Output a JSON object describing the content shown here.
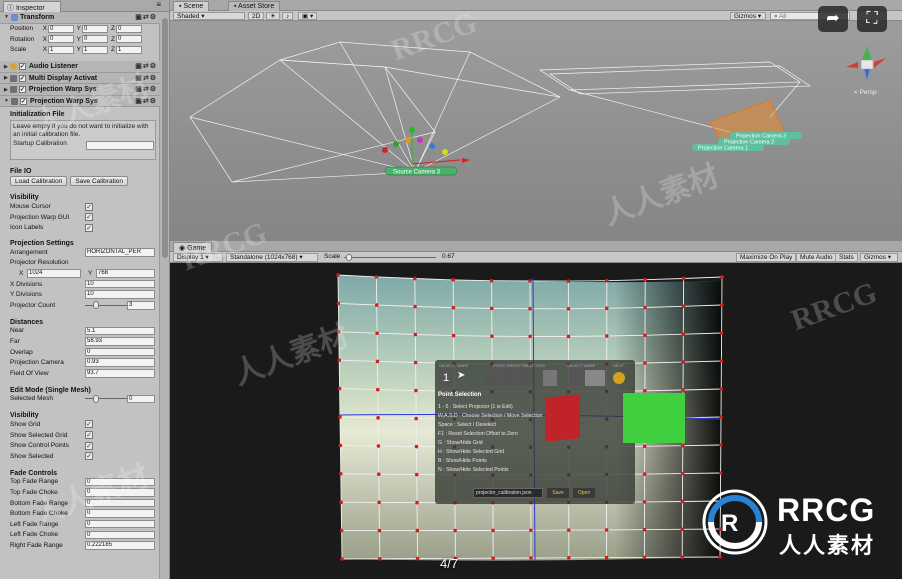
{
  "inspector": {
    "tab": "Inspector",
    "transform": {
      "title": "Transform",
      "rows": [
        {
          "label": "Position",
          "x": "0",
          "y": "0",
          "z": "0"
        },
        {
          "label": "Rotation",
          "x": "0",
          "y": "0",
          "z": "0"
        },
        {
          "label": "Scale",
          "x": "1",
          "y": "1",
          "z": "1"
        }
      ]
    },
    "components": [
      "Audio Listener",
      "Multi Display Activat",
      "Projection Warp Sys",
      "Projection Warp Sys"
    ],
    "init_file": {
      "heading": "Initialization File",
      "help": "Leave empty if you do not want to initialize with an initial calibration file.",
      "startup_label": "Startup Calibration",
      "startup_value": ""
    },
    "file_io": {
      "heading": "File IO",
      "load": "Load Calibration",
      "save": "Save Calibration"
    },
    "visibility": {
      "heading": "Visibility",
      "items": [
        {
          "label": "Mouse Cursor",
          "checked": true
        },
        {
          "label": "Projection Warp GUI",
          "checked": true
        },
        {
          "label": "Icon Labels",
          "checked": true
        }
      ]
    },
    "projection_settings": {
      "heading": "Projection Settings",
      "arrangement_label": "Arrangement",
      "arrangement_value": "HORIZONTAL_PER",
      "resolution_label": "Projector Resolution",
      "res_x_label": "X",
      "res_x": "1024",
      "res_y_label": "Y",
      "res_y": "768",
      "xdiv_label": "X Divisions",
      "xdiv": "10",
      "ydiv_label": "Y Divisions",
      "ydiv": "10",
      "count_label": "Projector Count",
      "count": "3"
    },
    "distances": {
      "heading": "Distances",
      "rows": [
        {
          "label": "Near",
          "value": "5.1"
        },
        {
          "label": "Far",
          "value": "58.93"
        },
        {
          "label": "Overlap",
          "value": "0"
        },
        {
          "label": "Projection Camera",
          "value": "0.93"
        },
        {
          "label": "Field Of View",
          "value": "93.7"
        }
      ]
    },
    "edit_mode": {
      "heading": "Edit Mode (Single Mesh)",
      "mesh_label": "Selected Mesh",
      "mesh_value": "0"
    },
    "visibility2": {
      "heading": "Visibility",
      "items": [
        {
          "label": "Show Grid",
          "checked": true
        },
        {
          "label": "Show Selected Grid",
          "checked": true
        },
        {
          "label": "Show Control Points",
          "checked": true
        },
        {
          "label": "Show Selected",
          "checked": true
        }
      ]
    },
    "fade": {
      "heading": "Fade Controls",
      "rows": [
        {
          "label": "Top Fade Range",
          "value": "0"
        },
        {
          "label": "Top Fade Choke",
          "value": "0"
        },
        {
          "label": "Bottom Fade Range",
          "value": "0"
        },
        {
          "label": "Bottom Fade Choke",
          "value": "0"
        },
        {
          "label": "Left Fade Range",
          "value": "0"
        },
        {
          "label": "Left Fade Choke",
          "value": "0"
        },
        {
          "label": "Right Fade Range",
          "value": "0.222185"
        }
      ]
    }
  },
  "scene": {
    "tabs": [
      "Scene",
      "Asset Store"
    ],
    "shading": "Shaded",
    "mode_2d": "2D",
    "gizmos": "Gizmos",
    "search_placeholder": "All",
    "persp": "< Persp",
    "cam_labels": [
      "Source Camera 3",
      "Projection Camera 3",
      "Projection Camera 2",
      "Projection Camera 1"
    ]
  },
  "game": {
    "tab": "Game",
    "display": "Display 1",
    "resolution": "Standalone (1024x768)",
    "scale_label": "Scale",
    "scale_value": "0.67",
    "toggles": [
      "Maximize On Play",
      "Mute Audio",
      "Stats",
      "Gizmos"
    ],
    "overlay": {
      "sections": [
        "SELECT",
        "WARP",
        "POINT GROUP SELECTION",
        "SELECT WARP",
        "HELP"
      ],
      "number": "1",
      "title": "Point Selection",
      "lines": [
        "1 - 5 : Select Projector (1 is Edit)",
        "W,A,S,D : Choose Selection / Move Selection",
        "Space : Select / Deselect",
        "F1 : Reset Selection Offset to Zero",
        "G : Show/Hide Grid",
        "H : Show/Hide Selected Grid",
        "B : Show/Hide Points",
        "N : Show/Hide Selected Points"
      ],
      "filename": "projector_calibration.json",
      "save": "Save",
      "open": "Open"
    }
  },
  "viewer": {
    "counter": "4/7"
  },
  "watermark": {
    "rrcg": "RRCG",
    "cn": "人人素材"
  },
  "colors": {
    "accent": "#2a6bd6",
    "grid": "#e8e8e8",
    "control_point": "#d81c1c"
  }
}
